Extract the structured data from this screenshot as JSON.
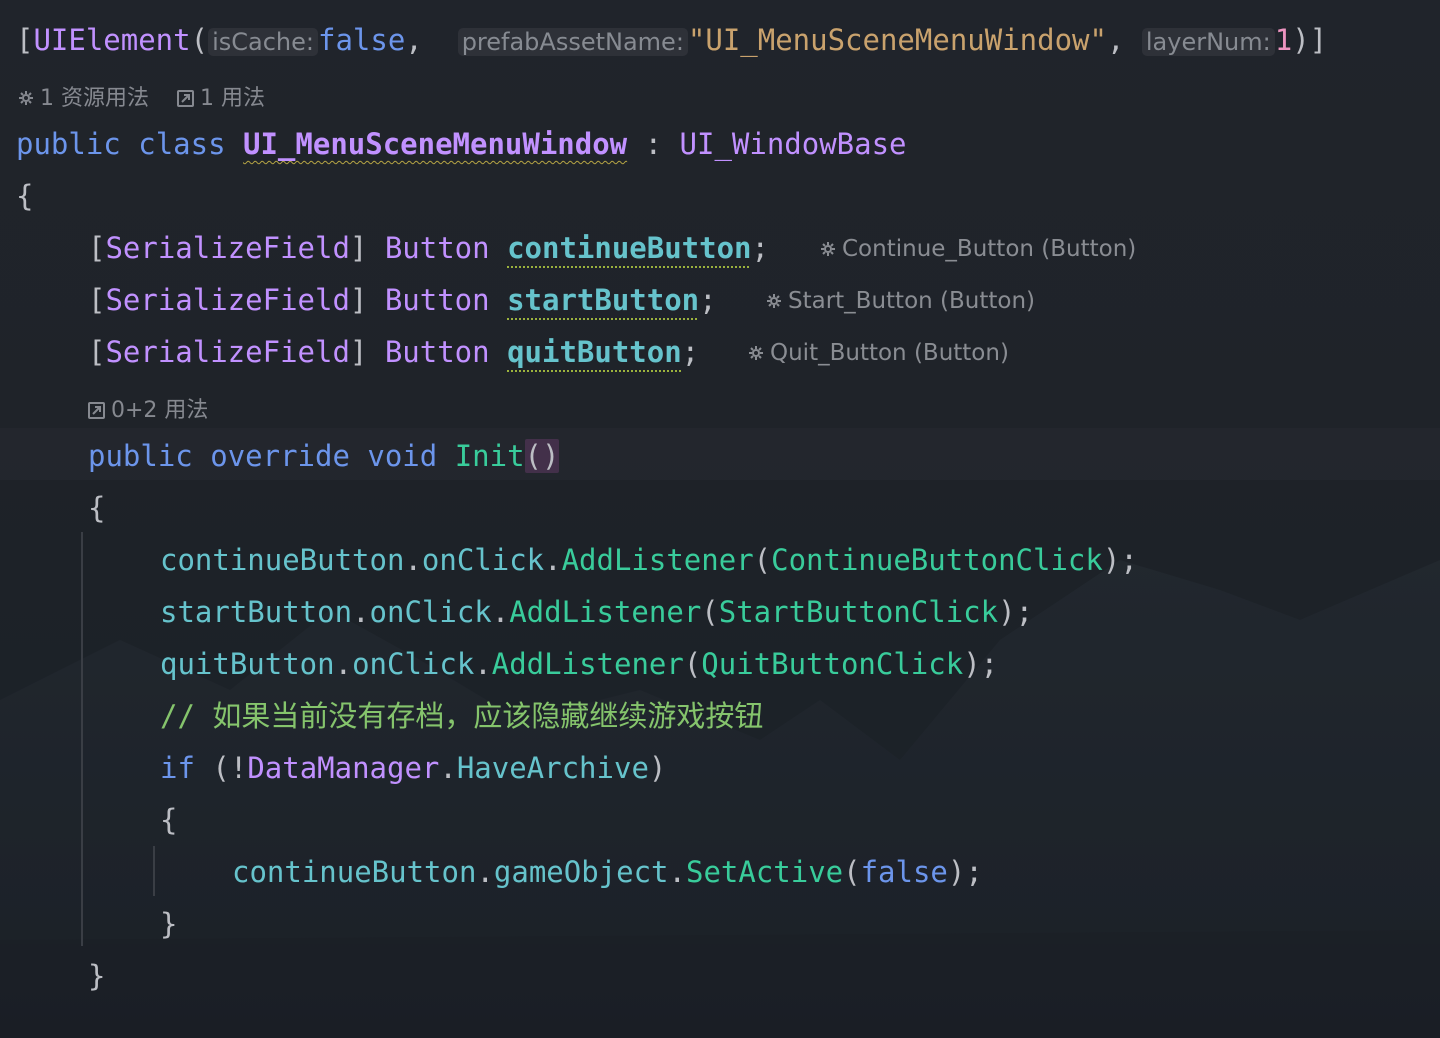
{
  "attribute": {
    "name": "UIElement",
    "param1_name": "isCache:",
    "param1_value": "false",
    "param2_name": "prefabAssetName:",
    "param2_value": "\"UI_MenuSceneMenuWindow\"",
    "param3_name": "layerNum:",
    "param3_value": "1"
  },
  "usage_hints": {
    "asset_usage": "1 资源用法",
    "code_usage": "1 用法",
    "method_usage": "0+2 用法"
  },
  "class_decl": {
    "kw_public": "public",
    "kw_class": "class",
    "name": "UI_MenuSceneMenuWindow",
    "colon": ":",
    "base": "UI_WindowBase",
    "open_brace": "{"
  },
  "fields": [
    {
      "attr": "SerializeField",
      "type": "Button",
      "name": "continueButton",
      "hint": "Continue_Button (Button)"
    },
    {
      "attr": "SerializeField",
      "type": "Button",
      "name": "startButton",
      "hint": "Start_Button (Button)"
    },
    {
      "attr": "SerializeField",
      "type": "Button",
      "name": "quitButton",
      "hint": "Quit_Button (Button)"
    }
  ],
  "method": {
    "kw_public": "public",
    "kw_override": "override",
    "kw_void": "void",
    "name": "Init",
    "parens": "()",
    "open_brace": "{",
    "close_brace": "}"
  },
  "body": {
    "listeners": [
      {
        "obj": "continueButton",
        "evt": "onClick",
        "call": "AddListener",
        "arg": "ContinueButtonClick"
      },
      {
        "obj": "startButton",
        "evt": "onClick",
        "call": "AddListener",
        "arg": "StartButtonClick"
      },
      {
        "obj": "quitButton",
        "evt": "onClick",
        "call": "AddListener",
        "arg": "QuitButtonClick"
      }
    ],
    "comment": "// 如果当前没有存档，应该隐藏继续游戏按钮",
    "if_kw": "if",
    "if_class": "DataManager",
    "if_prop": "HaveArchive",
    "inner_open": "{",
    "inner_obj": "continueButton",
    "inner_prop": "gameObject",
    "inner_call": "SetActive",
    "inner_arg": "false",
    "inner_close": "}"
  },
  "icons": [
    "unity-icon",
    "usage-arrow-icon"
  ]
}
